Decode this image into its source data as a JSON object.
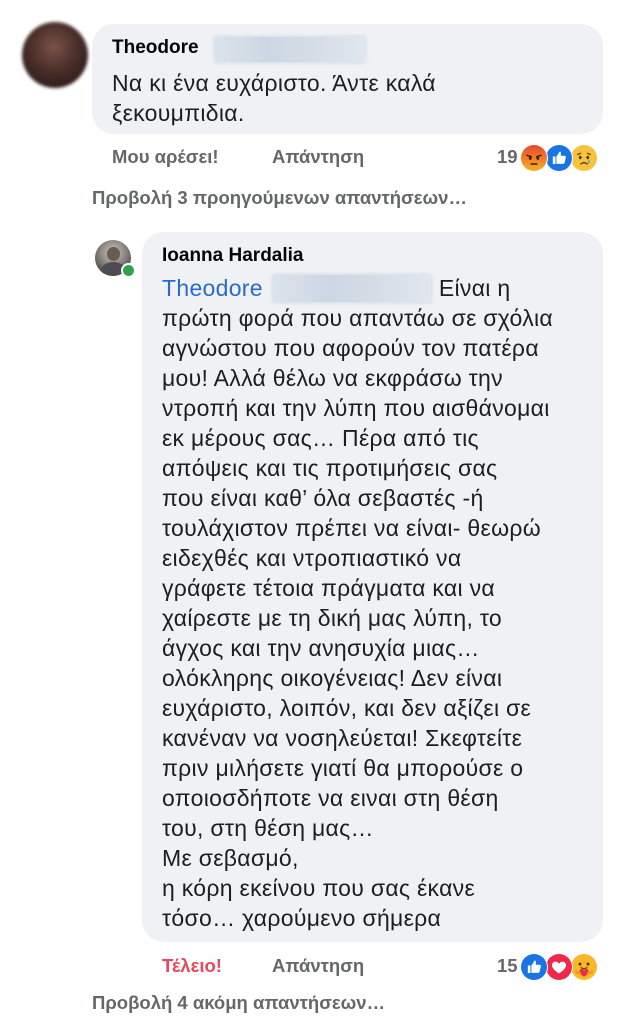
{
  "comment": {
    "author": "Theodore",
    "body_lines": [
      "Να κι ένα ευχάριστο. Άντε καλά",
      "ξεκουμπιδια."
    ],
    "actions": {
      "like": "Μου αρέσει!",
      "reply": "Απάντηση"
    },
    "reactions": {
      "count": "19",
      "icons": [
        "angry-icon",
        "like-icon",
        "sad-icon"
      ]
    }
  },
  "view_previous_replies": "Προβολή 3 προηγούμενων απαντήσεων…",
  "reply": {
    "author": "Ioanna Hardalia",
    "mention": "Theodore",
    "first_line_rest": "Είναι η",
    "body_lines": [
      "πρώτη φορά που απαντάω σε σχόλια",
      "αγνώστου που αφορούν τον πατέρα",
      "μου! Αλλά θέλω να εκφράσω την",
      "ντροπή και την λύπη που αισθάνομαι",
      "εκ μέρους σας… Πέρα από τις",
      "απόψεις και τις προτιμήσεις σας",
      "που είναι καθ’ όλα σεβαστές -ή",
      "τουλάχιστον πρέπει να είναι- θεωρώ",
      "ειδεχθές και ντροπιαστικό να",
      "γράφετε τέτοια πράγματα και να",
      "χαίρεστε με τη δική μας λύπη, το",
      "άγχος και την ανησυχία μιας…",
      "ολόκληρης οικογένειας! Δεν είναι",
      "ευχάριστο, λοιπόν, και δεν αξίζει σε",
      "κανέναν να νοσηλεύεται! Σκεφτείτε",
      "πριν μιλήσετε γιατί θα μπορούσε ο",
      "οποιοσδήποτε να ειναι στη θέση",
      "του, στη θέση μας…",
      "Με σεβασμό,",
      "η κόρη εκείνου που σας έκανε",
      "τόσο… χαρούμενο σήμερα"
    ],
    "actions": {
      "reaction": "Τέλειο!",
      "reply": "Απάντηση"
    },
    "reactions": {
      "count": "15",
      "icons": [
        "like-icon",
        "love-icon",
        "care-icon"
      ]
    }
  },
  "view_more_replies": "Προβολή 4 ακόμη απαντήσεων…",
  "colors": {
    "bubble": "#eff1f4",
    "meta_text": "#65676b",
    "mention": "#2a6bc9",
    "love_reaction_label": "#e8485a",
    "online_dot": "#31a24c"
  }
}
